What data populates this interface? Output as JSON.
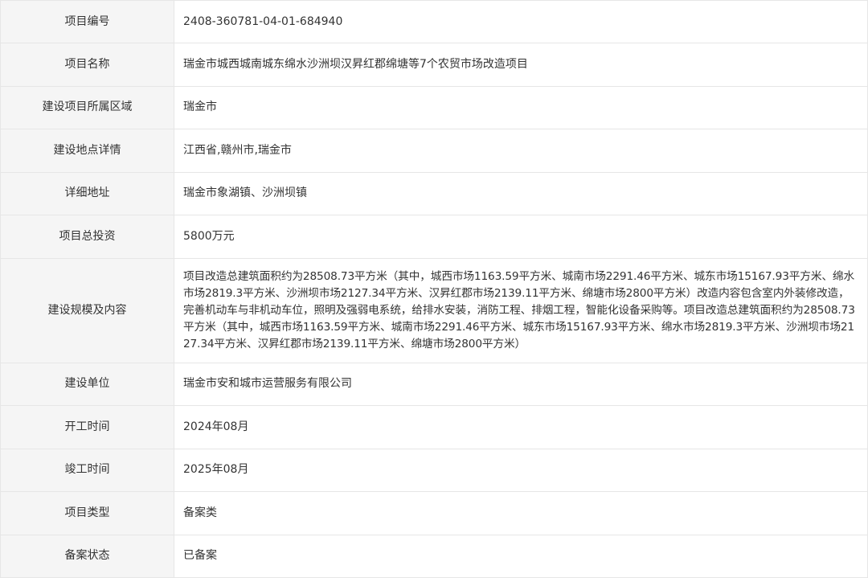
{
  "rows": [
    {
      "label": "项目编号",
      "value": "2408-360781-04-01-684940"
    },
    {
      "label": "项目名称",
      "value": "瑞金市城西城南城东绵水沙洲坝汉昇红郡绵塘等7个农贸市场改造项目"
    },
    {
      "label": "建设项目所属区域",
      "value": "瑞金市"
    },
    {
      "label": "建设地点详情",
      "value": "江西省,赣州市,瑞金市"
    },
    {
      "label": "详细地址",
      "value": "瑞金市象湖镇、沙洲坝镇"
    },
    {
      "label": "项目总投资",
      "value": "5800万元"
    },
    {
      "label": "建设规模及内容",
      "value": "项目改造总建筑面积约为28508.73平方米（其中，城西市场1163.59平方米、城南市场2291.46平方米、城东市场15167.93平方米、绵水市场2819.3平方米、沙洲坝市场2127.34平方米、汉昇红郡市场2139.11平方米、绵塘市场2800平方米）改造内容包含室内外装修改造，完善机动车与非机动车位，照明及强弱电系统，给排水安装，消防工程、排烟工程，智能化设备采购等。项目改造总建筑面积约为28508.73平方米（其中，城西市场1163.59平方米、城南市场2291.46平方米、城东市场15167.93平方米、绵水市场2819.3平方米、沙洲坝市场2127.34平方米、汉昇红郡市场2139.11平方米、绵塘市场2800平方米）"
    },
    {
      "label": "建设单位",
      "value": "瑞金市安和城市运营服务有限公司"
    },
    {
      "label": "开工时间",
      "value": "2024年08月"
    },
    {
      "label": "竣工时间",
      "value": "2025年08月"
    },
    {
      "label": "项目类型",
      "value": "备案类"
    },
    {
      "label": "备案状态",
      "value": "已备案"
    }
  ]
}
